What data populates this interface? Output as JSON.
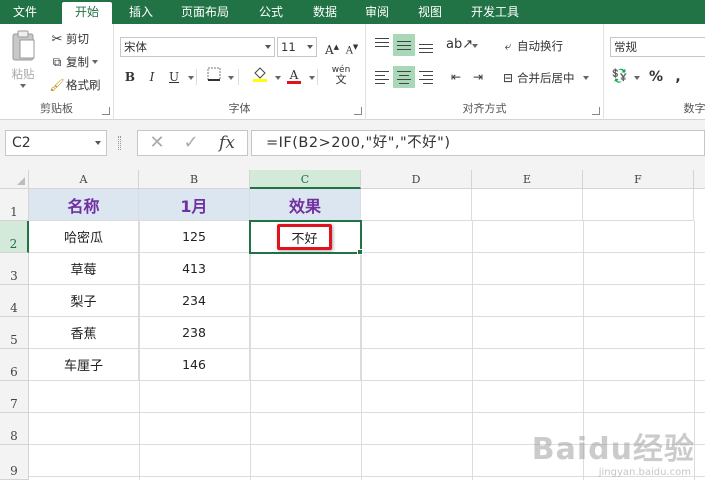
{
  "tabs": [
    "文件",
    "开始",
    "插入",
    "页面布局",
    "公式",
    "数据",
    "审阅",
    "视图",
    "开发工具"
  ],
  "clipboard": {
    "paste": "粘贴",
    "cut": "剪切",
    "copy": "复制",
    "format_painter": "格式刷",
    "label": "剪贴板"
  },
  "font": {
    "name": "宋体",
    "size": "11",
    "bold": "B",
    "italic": "I",
    "underline": "U",
    "grow": "A",
    "shrink": "A",
    "font_color": "A",
    "phonetic": "wén",
    "label": "字体"
  },
  "alignment": {
    "wrap_text": "自动换行",
    "merge_center": "合并后居中",
    "label": "对齐方式"
  },
  "number": {
    "format": "常规",
    "percent": "%",
    "comma": ",",
    "label": "数字"
  },
  "formula_bar": {
    "name_box": "C2",
    "formula": "=IF(B2>200,\"好\",\"不好\")",
    "cancel": "✕",
    "enter": "✓",
    "fx": "fx"
  },
  "columns": [
    "A",
    "B",
    "C",
    "D",
    "E",
    "F"
  ],
  "rows": [
    "1",
    "2",
    "3",
    "4",
    "5",
    "6",
    "7",
    "8",
    "9"
  ],
  "header_row": [
    "名称",
    "1月",
    "效果"
  ],
  "data_rows": [
    {
      "name": "哈密瓜",
      "jan": "125",
      "effect": "不好"
    },
    {
      "name": "草莓",
      "jan": "413",
      "effect": ""
    },
    {
      "name": "梨子",
      "jan": "234",
      "effect": ""
    },
    {
      "name": "香蕉",
      "jan": "238",
      "effect": ""
    },
    {
      "name": "车厘子",
      "jan": "146",
      "effect": ""
    }
  ],
  "colors": {
    "accent": "#217346",
    "header_fill": "#dce6f1",
    "header_text": "#7030a0",
    "highlight": "#e0141e"
  },
  "watermark": {
    "logo": "Baidu经验",
    "url": "jingyan.baidu.com"
  }
}
